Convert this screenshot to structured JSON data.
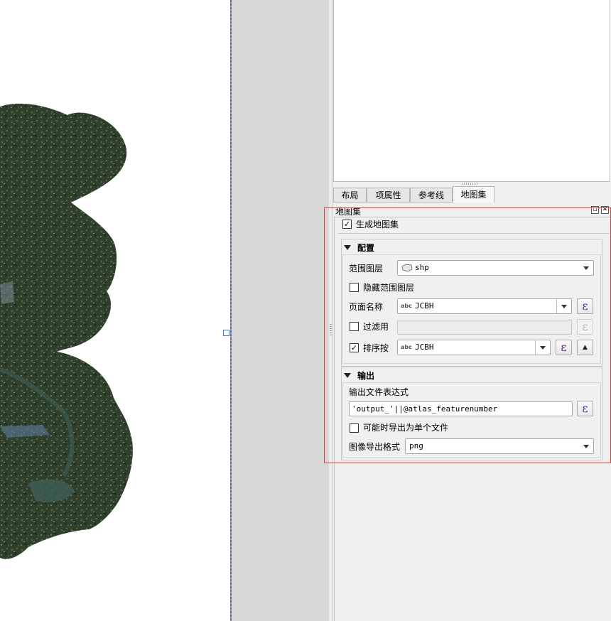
{
  "tabs": [
    {
      "label": "布局",
      "active": false
    },
    {
      "label": "项属性",
      "active": false
    },
    {
      "label": "参考线",
      "active": false
    },
    {
      "label": "地图集",
      "active": true
    }
  ],
  "atlas_dock": {
    "title": "地图集",
    "generate_atlas": {
      "label": "生成地图集",
      "checked": true
    },
    "config": {
      "heading": "配置",
      "coverage_layer": {
        "label": "范围图层",
        "value": "shp",
        "icon": "polygon-layer-icon"
      },
      "hide_coverage": {
        "label": "隐藏范围图层",
        "checked": false
      },
      "page_name": {
        "label": "页面名称",
        "value": "JCBH",
        "type_badge": "abc"
      },
      "filter": {
        "label": "过滤用",
        "checked": false,
        "value": ""
      },
      "sort_by": {
        "label": "排序按",
        "checked": true,
        "value": "JCBH",
        "type_badge": "abc"
      }
    },
    "output": {
      "heading": "输出",
      "filename_expr_label": "输出文件表达式",
      "filename_expr": "'output_'||@atlas_featurenumber",
      "single_file": {
        "label": "可能时导出为单个文件",
        "checked": false
      },
      "image_format": {
        "label": "图像导出格式",
        "value": "png"
      }
    }
  },
  "symbols": {
    "epsilon": "ε",
    "check": "✓",
    "sort_asc": "▲"
  },
  "colors": {
    "highlight_box": "#e03a3a",
    "expression_icon": "#5a2a86",
    "map_dark_green": "#2d3f2b"
  }
}
